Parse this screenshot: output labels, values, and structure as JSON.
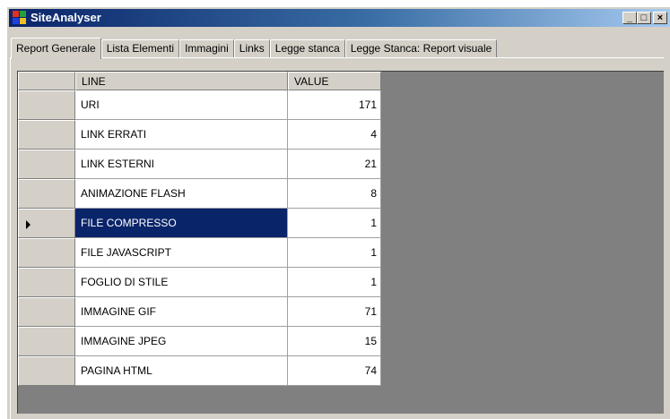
{
  "window": {
    "title": "SiteAnalyser",
    "buttons": {
      "minimize": "_",
      "maximize": "□",
      "close": "×"
    }
  },
  "tabs": [
    {
      "label": "Report Generale",
      "active": true
    },
    {
      "label": "Lista Elementi",
      "active": false
    },
    {
      "label": "Immagini",
      "active": false
    },
    {
      "label": "Links",
      "active": false
    },
    {
      "label": "Legge stanca",
      "active": false
    },
    {
      "label": "Legge Stanca: Report visuale",
      "active": false
    }
  ],
  "grid": {
    "columns": [
      "LINE",
      "VALUE"
    ],
    "selected_index": 4,
    "rows": [
      {
        "line": "URI",
        "value": "171"
      },
      {
        "line": "LINK ERRATI",
        "value": "4"
      },
      {
        "line": "LINK ESTERNI",
        "value": "21"
      },
      {
        "line": "ANIMAZIONE FLASH",
        "value": "8"
      },
      {
        "line": "FILE COMPRESSO",
        "value": "1"
      },
      {
        "line": "FILE JAVASCRIPT",
        "value": "1"
      },
      {
        "line": "FOGLIO DI STILE",
        "value": "1"
      },
      {
        "line": "IMMAGINE GIF",
        "value": "71"
      },
      {
        "line": "IMMAGINE JPEG",
        "value": "15"
      },
      {
        "line": "PAGINA HTML",
        "value": "74"
      }
    ]
  },
  "colors": {
    "titlebar_start": "#0a246a",
    "titlebar_end": "#a6caf0",
    "selection": "#0a246a",
    "grid_background": "#808080",
    "face": "#d4d0c8"
  }
}
